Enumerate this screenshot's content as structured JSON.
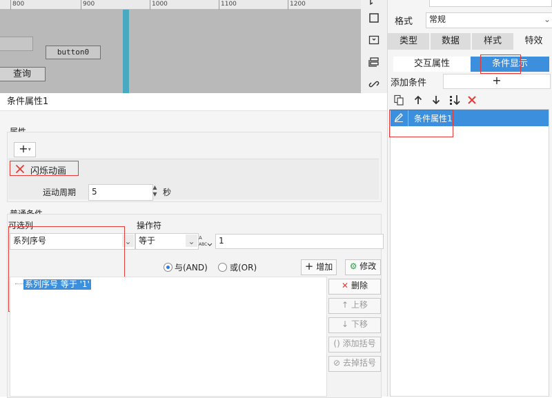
{
  "canvas": {
    "ruler_labels": [
      "800",
      "900",
      "1000",
      "1100",
      "1200"
    ],
    "button0_label": "button0",
    "query_label": "查询"
  },
  "right_panel": {
    "format_label": "格式",
    "format_value": "常规",
    "tabs": [
      "类型",
      "数据",
      "样式",
      "特效"
    ],
    "sub_tabs": [
      "交互属性",
      "条件显示"
    ],
    "add_condition_label": "添加条件",
    "add_icon": "plus-icon",
    "toolbar_icons": [
      "copy-icon",
      "arrow-up-icon",
      "arrow-down-icon",
      "sort-icon",
      "delete-icon"
    ],
    "conditions": [
      "条件属性1"
    ],
    "accent_color": "#3b8fdd"
  },
  "dialog": {
    "title": "条件属性1",
    "properties_legend": "属性",
    "animation_label": "闪烁动画",
    "period_label": "运动周期",
    "period_value": "5",
    "period_unit": "秒",
    "general_legend": "普通条件",
    "optional_column_label": "可选列",
    "optional_column_value": "系列序号",
    "operator_label": "操作符",
    "operator_value": "等于",
    "value": "1",
    "and_label": "与(AND)",
    "or_label": "或(OR)",
    "add_label": "增加",
    "modify_label": "修改",
    "delete_label": "删除",
    "up_label": "上移",
    "down_label": "下移",
    "add_bracket_label": "添加括号",
    "remove_bracket_label": "去掉括号",
    "condition_expression": "系列序号 等于 '1'"
  }
}
